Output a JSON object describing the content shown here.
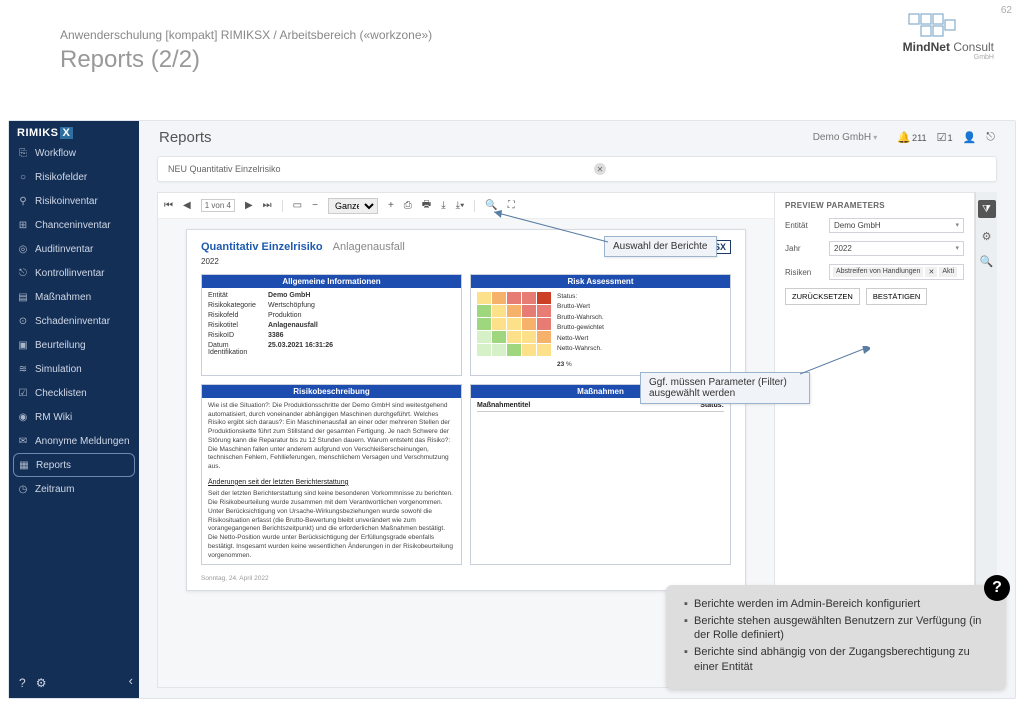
{
  "page_number": "62",
  "brand": {
    "name": "MindNet",
    "suffix": "Consult",
    "sub": "GmbH"
  },
  "slide": {
    "breadcrumb": "Anwenderschulung [kompakt] RIMIKSX / Arbeitsbereich («workzone»)",
    "title": "Reports (2/2)"
  },
  "sidebar": {
    "logo": "RIMIKS",
    "logo_x": "X",
    "items": [
      {
        "icon": "⎘",
        "label": "Workflow"
      },
      {
        "icon": "○",
        "label": "Risikofelder"
      },
      {
        "icon": "⚲",
        "label": "Risikoinventar"
      },
      {
        "icon": "⊞",
        "label": "Chanceninventar"
      },
      {
        "icon": "◎",
        "label": "Auditinventar"
      },
      {
        "icon": "⎋",
        "label": "Kontrollinventar"
      },
      {
        "icon": "▤",
        "label": "Maßnahmen"
      },
      {
        "icon": "⊙",
        "label": "Schadeninventar"
      },
      {
        "icon": "▣",
        "label": "Beurteilung"
      },
      {
        "icon": "≋",
        "label": "Simulation"
      },
      {
        "icon": "☑",
        "label": "Checklisten"
      },
      {
        "icon": "◉",
        "label": "RM Wiki"
      },
      {
        "icon": "✉",
        "label": "Anonyme Meldungen"
      },
      {
        "icon": "▦",
        "label": "Reports"
      },
      {
        "icon": "◷",
        "label": "Zeitraum"
      }
    ],
    "active_index": 13
  },
  "topbar": {
    "title": "Reports",
    "entity": "Demo GmbH",
    "bell_count": "211",
    "check_count": "1"
  },
  "filter_value": "NEU Quantitativ Einzelrisiko",
  "viewer_toolbar": {
    "page_of": "1 von 4",
    "zoom": "Ganze S…"
  },
  "report": {
    "title1": "Quantitativ Einzelrisiko",
    "title2": "Anlagenausfall",
    "logo": "RIMIKSX",
    "year": "2022",
    "box_allg": "Allgemeine Informationen",
    "box_risk": "Risk Assessment",
    "box_desc": "Risikobeschreibung",
    "box_mass": "Maßnahmen",
    "allg": {
      "l_ent": "Entität",
      "v_ent": "Demo GmbH",
      "l_kat": "Risikokategorie",
      "v_kat": "Wertschöpfung",
      "l_feld": "Risikofeld",
      "v_feld": "Produktion",
      "l_titel": "Risikotitel",
      "v_titel": "Anlagenausfall",
      "l_id": "RisikoID",
      "v_id": "3386",
      "l_dat": "Datum Identifikation",
      "v_dat": "25.03.2021 16:31:26"
    },
    "ra": {
      "l_status": "Status:",
      "l_bw": "Brutto-Wert",
      "l_bwa": "Brutto-Wahrsch.",
      "l_bg": "Brutto-gewichtet",
      "l_nw": "Netto-Wert",
      "l_nwa": "Netto-Wahrsch.",
      "pct": "23",
      "unit": "%"
    },
    "desc_text": "Wie ist die Situation?: Die Produktionsschritte der Demo GmbH sind weitestgehend automatisiert, durch voneinander abhängigen Maschinen durchgeführt.   Welches Risiko ergibt sich daraus?: Ein Maschinenausfall an einer oder mehreren Stellen der Produktionskette führt zum Stillstand der gesamten Fertigung. Je nach Schwere der Störung kann die Reparatur bis zu 12 Stunden dauern.   Warum entsteht das Risiko?: Die Maschinen fallen unter anderem aufgrund von Verschleißerscheinungen, technischen Fehlern, Fehllieferungen, menschlichem Versagen und Verschmutzung aus.",
    "desc_change_h": "Änderungen seit der letzten Berichterstattung",
    "desc_change": "Seit der letzten Berichterstattung sind keine besonderen Vorkommnisse zu berichten. Die Risikobeurteilung wurde zusammen mit dem Verantwortlichen vorgenommen. Unter Berücksichtigung von Ursache-Wirkungsbeziehungen wurde sowohl die Risikosituation erfasst (die Brutto-Bewertung bleibt unverändert wie zum vorangegangenen Berichtszeitpunkt) und die erforderlichen Maßnahmen bestätigt. Die Netto-Position wurde unter Berücksichtigung der Erfüllungsgrade ebenfalls bestätigt. Insgesamt wurden keine wesentlichen Änderungen in der Risikobeurteilung vorgenommen.",
    "mass_left": "Maßnahmentitel",
    "mass_right": "Status:",
    "footer_date": "Sonntag, 24. April 2022"
  },
  "params": {
    "heading": "PREVIEW PARAMETERS",
    "l_ent": "Entität",
    "v_ent": "Demo GmbH",
    "l_jahr": "Jahr",
    "v_jahr": "2022",
    "l_risk": "Risiken",
    "tag1": "Abstreifen von Handlungen",
    "tag_x": "✕",
    "tag2": "Akti",
    "btn_reset": "ZURÜCKSETZEN",
    "btn_ok": "BESTÄTIGEN"
  },
  "callouts": {
    "c1": "Auswahl der Berichte",
    "c2": "Ggf. müssen Parameter (Filter) ausgewählt werden"
  },
  "info": {
    "items": [
      "Berichte werden im Admin-Bereich konfiguriert",
      "Berichte stehen ausgewählten Benutzern zur Verfügung (in der Rolle definiert)",
      "Berichte sind abhängig von der Zugangsberechtigung zu einer Entität"
    ]
  }
}
